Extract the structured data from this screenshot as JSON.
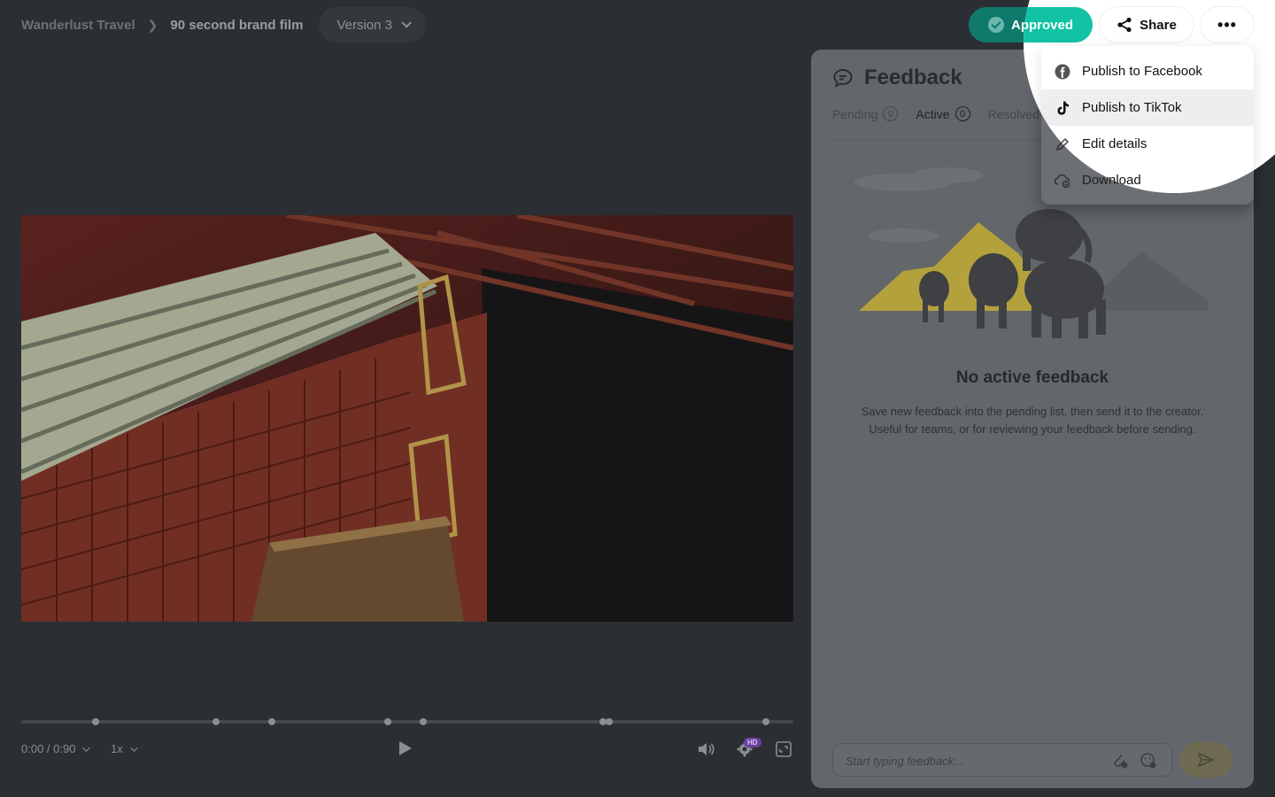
{
  "breadcrumb": {
    "root": "Wanderlust Travel",
    "current": "90 second brand film"
  },
  "version": {
    "label": "Version 3"
  },
  "actions": {
    "approved_label": "Approved",
    "share_label": "Share",
    "more_label": "•••"
  },
  "menu": {
    "items": [
      {
        "label": "Publish to Facebook",
        "icon": "facebook-icon"
      },
      {
        "label": "Publish to TikTok",
        "icon": "tiktok-icon"
      },
      {
        "label": "Edit details",
        "icon": "pencil-icon"
      },
      {
        "label": "Download",
        "icon": "cloud-download-icon"
      }
    ]
  },
  "feedback": {
    "title": "Feedback",
    "tabs": [
      {
        "label": "Pending",
        "count": "0"
      },
      {
        "label": "Active",
        "count": "0"
      },
      {
        "label": "Resolved"
      }
    ],
    "empty_title": "No active feedback",
    "empty_desc": "Save new feedback into the pending list, then send it to the creator. Useful for teams, or for reviewing your feedback before sending.",
    "input_placeholder": "Start typing feedback..."
  },
  "player": {
    "time": "0:00 / 0:90",
    "speed": "1x",
    "quality_badge": "HD",
    "markers": [
      0.096,
      0.252,
      0.325,
      0.475,
      0.521,
      0.754,
      0.761,
      0.964
    ]
  },
  "colors": {
    "approved": "#12c2a5",
    "background": "#2b2e33",
    "panel": "#63666b",
    "accent_send": "#f5e27a"
  }
}
